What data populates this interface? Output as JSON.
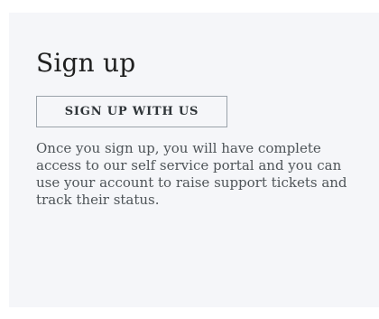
{
  "signup": {
    "title": "Sign up",
    "button_label": "SIGN UP WITH US",
    "description": "Once you sign up, you will have complete access to our self service portal and you can use your account to raise support tickets and track their status."
  },
  "colors": {
    "panel_background": "#f5f6f9",
    "title_text": "#1f1f1f",
    "body_text": "#4e5458",
    "button_border": "#9aa2aa"
  }
}
